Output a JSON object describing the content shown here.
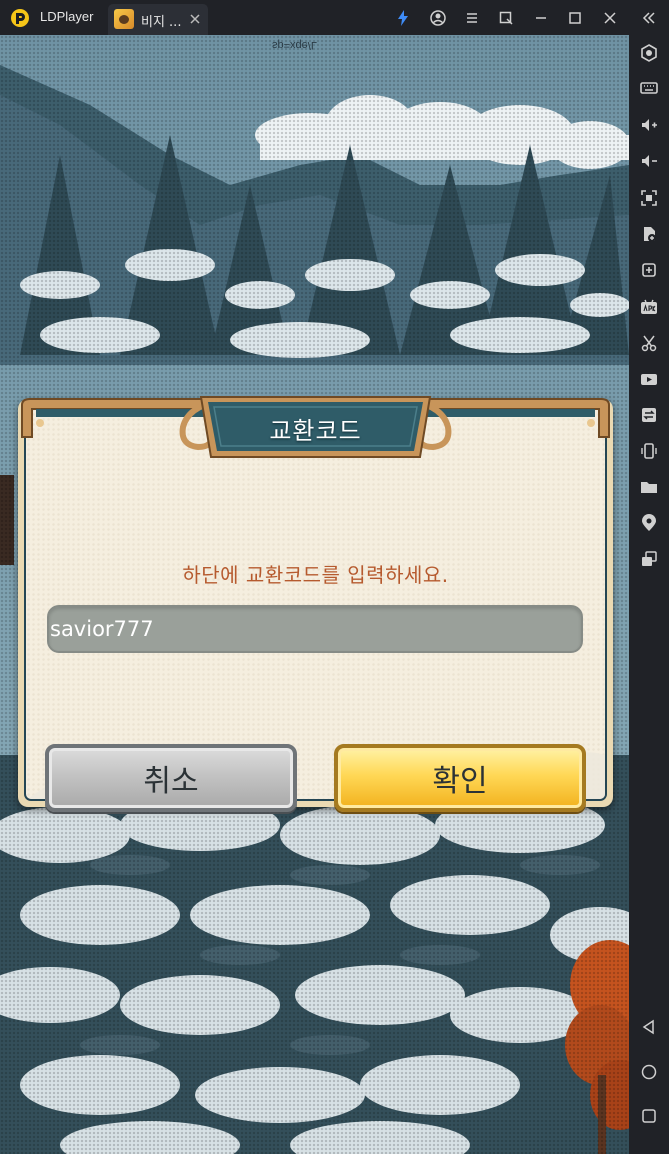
{
  "window": {
    "app_name": "LDPlayer",
    "tab_label": "비지 ...",
    "colors": {
      "titlebar": "#202227",
      "sidebar": "#202227"
    },
    "title_icons": [
      "lightning-icon",
      "account-icon",
      "menu-icon",
      "shrink-icon",
      "minimize-icon",
      "maximize-icon",
      "close-icon",
      "collapse-sidebar-icon"
    ]
  },
  "sidebar": {
    "icons": [
      "gamepad-settings-icon",
      "keyboard-icon",
      "volume-up-icon",
      "volume-down-icon",
      "screenshot-icon",
      "add-lock-icon",
      "add-app-icon",
      "apk-install-icon",
      "scissors-icon",
      "record-video-icon",
      "sync-icon",
      "shake-icon",
      "folder-icon",
      "location-icon",
      "multi-window-icon"
    ],
    "nav_icons": [
      "back-icon",
      "home-icon",
      "recent-apps-icon"
    ]
  },
  "game": {
    "mirror_text": "sp=xqe/L"
  },
  "dialog": {
    "title": "교환코드",
    "instruction": "하단에 교환코드를 입력하세요.",
    "code_value": "savior777",
    "cancel_label": "취소",
    "confirm_label": "확인",
    "colors": {
      "title_banner": "#2f5c68",
      "frame_gold": "#c8955a",
      "instruction_text": "#b65a2e",
      "confirm_button": "#ffd856",
      "cancel_button": "#c3c3c3"
    }
  }
}
